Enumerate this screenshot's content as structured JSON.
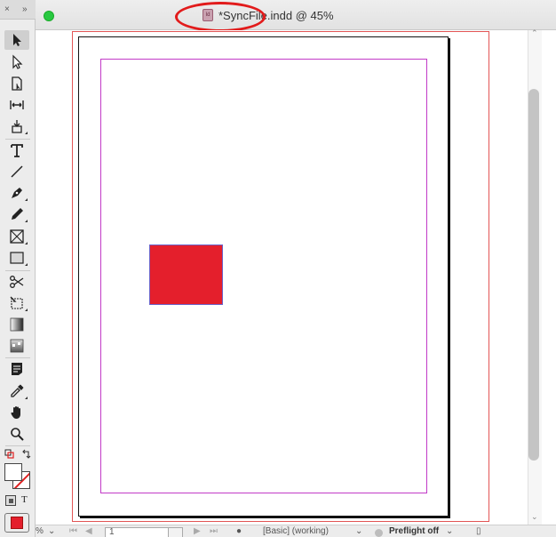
{
  "window": {
    "title": "*SyncFile.indd @ 45%"
  },
  "tools_panel": {
    "close_glyph": "×",
    "collapse_glyph": "»"
  },
  "tools": [
    {
      "name": "selection-tool",
      "icon": "arrow-solid-icon",
      "active": true
    },
    {
      "name": "direct-selection-tool",
      "icon": "arrow-hollow-icon"
    },
    {
      "name": "page-tool",
      "icon": "page-icon"
    },
    {
      "name": "gap-tool",
      "icon": "gap-icon"
    },
    {
      "name": "content-collector-tool",
      "icon": "collector-icon"
    },
    {
      "name": "type-tool",
      "icon": "type-icon"
    },
    {
      "name": "line-tool",
      "icon": "line-icon"
    },
    {
      "name": "pen-tool",
      "icon": "pen-icon"
    },
    {
      "name": "pencil-tool",
      "icon": "pencil-icon"
    },
    {
      "name": "rectangle-frame-tool",
      "icon": "frame-icon"
    },
    {
      "name": "rectangle-tool",
      "icon": "rectangle-icon"
    },
    {
      "name": "scissors-tool",
      "icon": "scissors-icon"
    },
    {
      "name": "free-transform-tool",
      "icon": "transform-icon"
    },
    {
      "name": "gradient-swatch-tool",
      "icon": "gradient-icon"
    },
    {
      "name": "gradient-feather-tool",
      "icon": "feather-icon"
    },
    {
      "name": "note-tool",
      "icon": "note-icon"
    },
    {
      "name": "eyedropper-tool",
      "icon": "eyedropper-icon"
    },
    {
      "name": "hand-tool",
      "icon": "hand-icon"
    },
    {
      "name": "zoom-tool",
      "icon": "zoom-icon"
    }
  ],
  "formatting": {
    "text_label": "T"
  },
  "statusbar": {
    "zoom_fragment": "%",
    "page_number": "1",
    "profile": "[Basic] (working)",
    "preflight": "Preflight off"
  },
  "colors": {
    "accent_red": "#e41f2c",
    "margin_guide": "#c23ac7",
    "bleed_guide": "#e25555"
  }
}
